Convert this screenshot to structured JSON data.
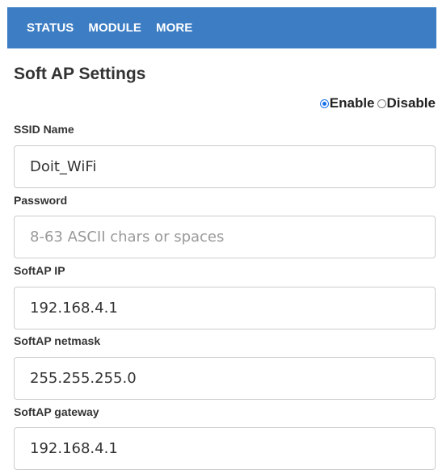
{
  "nav": {
    "items": [
      {
        "label": "STATUS"
      },
      {
        "label": "MODULE"
      },
      {
        "label": "MORE"
      }
    ]
  },
  "page": {
    "title": "Soft AP Settings"
  },
  "mode": {
    "enable_label": "Enable",
    "disable_label": "Disable",
    "selected": "Enable"
  },
  "fields": {
    "ssid": {
      "label": "SSID Name",
      "value": "Doit_WiFi",
      "placeholder": ""
    },
    "password": {
      "label": "Password",
      "value": "",
      "placeholder": "8-63 ASCII chars or spaces"
    },
    "ip": {
      "label": "SoftAP IP",
      "value": "192.168.4.1",
      "placeholder": ""
    },
    "netmask": {
      "label": "SoftAP netmask",
      "value": "255.255.255.0",
      "placeholder": ""
    },
    "gateway": {
      "label": "SoftAP gateway",
      "value": "192.168.4.1",
      "placeholder": ""
    }
  },
  "colors": {
    "navbar": "#3c7dc4",
    "radio_accent": "#1a73e8"
  }
}
